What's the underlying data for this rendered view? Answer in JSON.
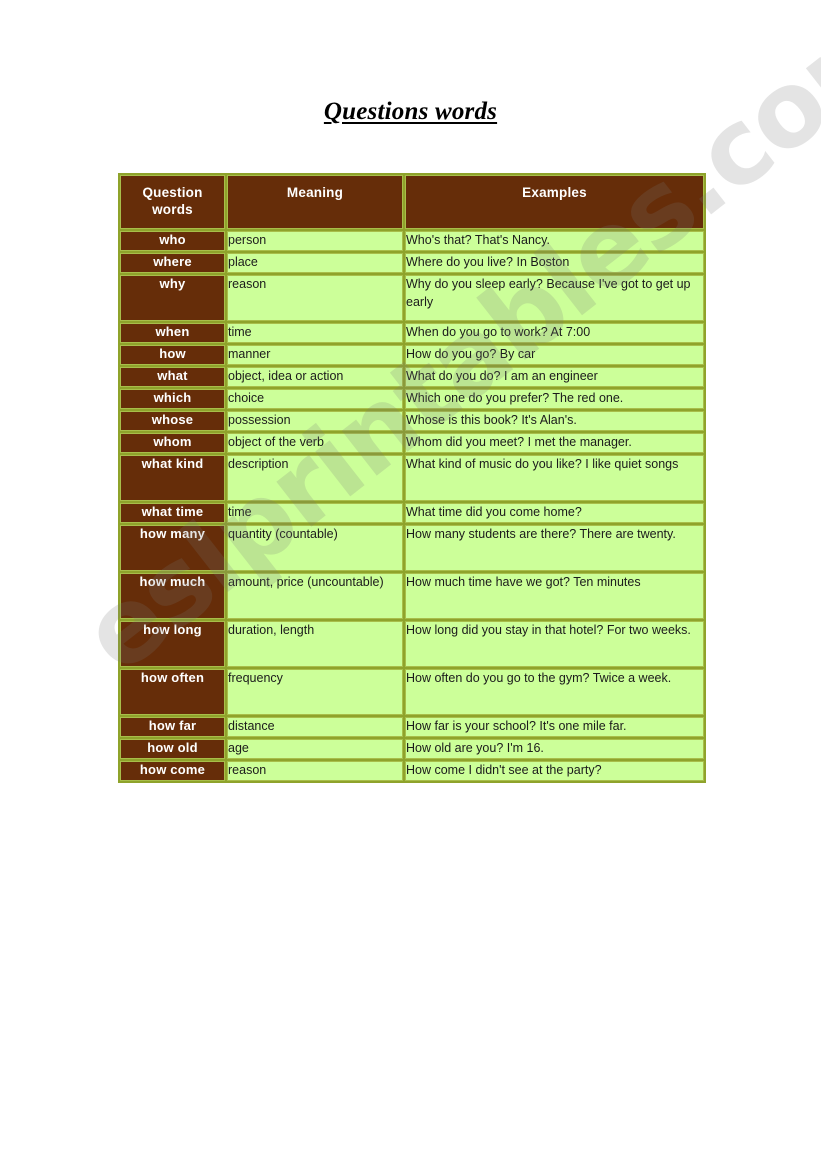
{
  "page": {
    "title": "Questions words",
    "watermark": "eslprintables.com",
    "background": "#ffffff"
  },
  "colors": {
    "header_brown": "#662D09",
    "cell_green": "#CCFF99",
    "grid_olive": "#8FA32B",
    "border_light_olive": "#A8BE4A",
    "text_dark": "#1b1b1b",
    "text_light": "#ffffff"
  },
  "table": {
    "columns": [
      "Question words",
      "Meaning",
      "Examples"
    ],
    "rows": [
      {
        "word": "who",
        "meaning": "person",
        "example": "Who's that? That's Nancy.",
        "tall": false
      },
      {
        "word": "where",
        "meaning": "place",
        "example": "Where do you live? In Boston",
        "tall": false
      },
      {
        "word": "why",
        "meaning": "reason",
        "example": "Why do you sleep early? Because I've got to get up early",
        "tall": true
      },
      {
        "word": "when",
        "meaning": "time",
        "example": "When do you go to work? At 7:00",
        "tall": false
      },
      {
        "word": "how",
        "meaning": "manner",
        "example": "How do you go? By car",
        "tall": false
      },
      {
        "word": "what",
        "meaning": "object, idea or action",
        "example": "What do you do? I am an engineer",
        "tall": false
      },
      {
        "word": "which",
        "meaning": "choice",
        "example": "Which one do you prefer? The red one.",
        "tall": false
      },
      {
        "word": "whose",
        "meaning": "possession",
        "example": "Whose is this book? It's Alan's.",
        "tall": false
      },
      {
        "word": "whom",
        "meaning": "object of the verb",
        "example": "Whom did you meet? I met the manager.",
        "tall": false
      },
      {
        "word": "what kind",
        "meaning": "description",
        "example": "What kind of music do you like? I like quiet songs",
        "tall": true
      },
      {
        "word": "what time",
        "meaning": "time",
        "example": "What time did you come home?",
        "tall": false
      },
      {
        "word": "how many",
        "meaning": "quantity (countable)",
        "example": "How many students are there? There are twenty.",
        "tall": true
      },
      {
        "word": "how much",
        "meaning": "amount, price (uncountable)",
        "example": "How much time have we got? Ten minutes",
        "tall": true
      },
      {
        "word": "how long",
        "meaning": "duration, length",
        "example": "How long did you stay in that hotel? For two weeks.",
        "tall": true
      },
      {
        "word": "how often",
        "meaning": "frequency",
        "example": "How often do you go to the gym? Twice a week.",
        "tall": true
      },
      {
        "word": "how far",
        "meaning": "distance",
        "example": "How far is your school? It's one mile far.",
        "tall": false
      },
      {
        "word": "how old",
        "meaning": "age",
        "example": "How old are you? I'm 16.",
        "tall": false
      },
      {
        "word": "how come",
        "meaning": "reason",
        "example": "How come I didn't see at the party?",
        "tall": false
      }
    ]
  }
}
